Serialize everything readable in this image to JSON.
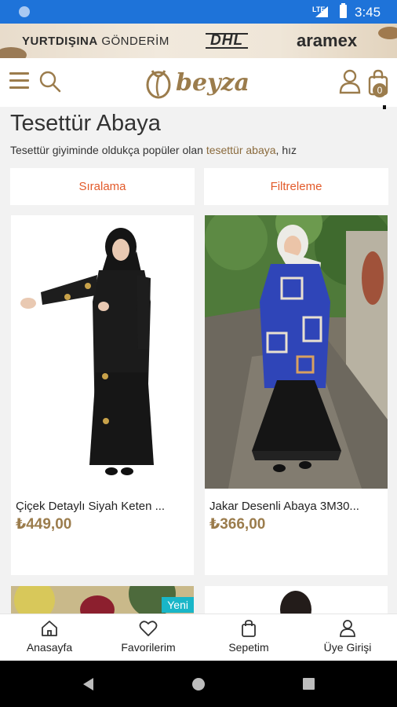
{
  "status_bar": {
    "network": "LTE",
    "time": "3:45"
  },
  "promo": {
    "text_bold": "YURTDIŞINA",
    "text_rest": " GÖNDERİM",
    "carrier1": "DHL",
    "carrier2": "aramex"
  },
  "header": {
    "brand": "beyza",
    "cart_count": "0"
  },
  "category": {
    "title": "Tesettür Abaya",
    "desc_before": "Tesettür giyiminde oldukça popüler olan ",
    "desc_link": "tesettür abaya",
    "desc_after": ", hız"
  },
  "toolbar": {
    "sort_label": "Sıralama",
    "filter_label": "Filtreleme"
  },
  "products": [
    {
      "name": "Çiçek Detaylı Siyah Keten ...",
      "price": "₺449,00"
    },
    {
      "name": "Jakar Desenli Abaya 3M30...",
      "price": "₺366,00"
    },
    {
      "badge": "Yeni"
    }
  ],
  "bottom_nav": [
    {
      "label": "Anasayfa",
      "icon": "home-icon"
    },
    {
      "label": "Favorilerim",
      "icon": "heart-icon"
    },
    {
      "label": "Sepetim",
      "icon": "bag-icon"
    },
    {
      "label": "Üye Girişi",
      "icon": "user-icon"
    }
  ],
  "colors": {
    "accent": "#9b7c4c",
    "orange": "#e25a2a",
    "status_blue": "#1e73d9",
    "badge": "#19b6c8"
  }
}
